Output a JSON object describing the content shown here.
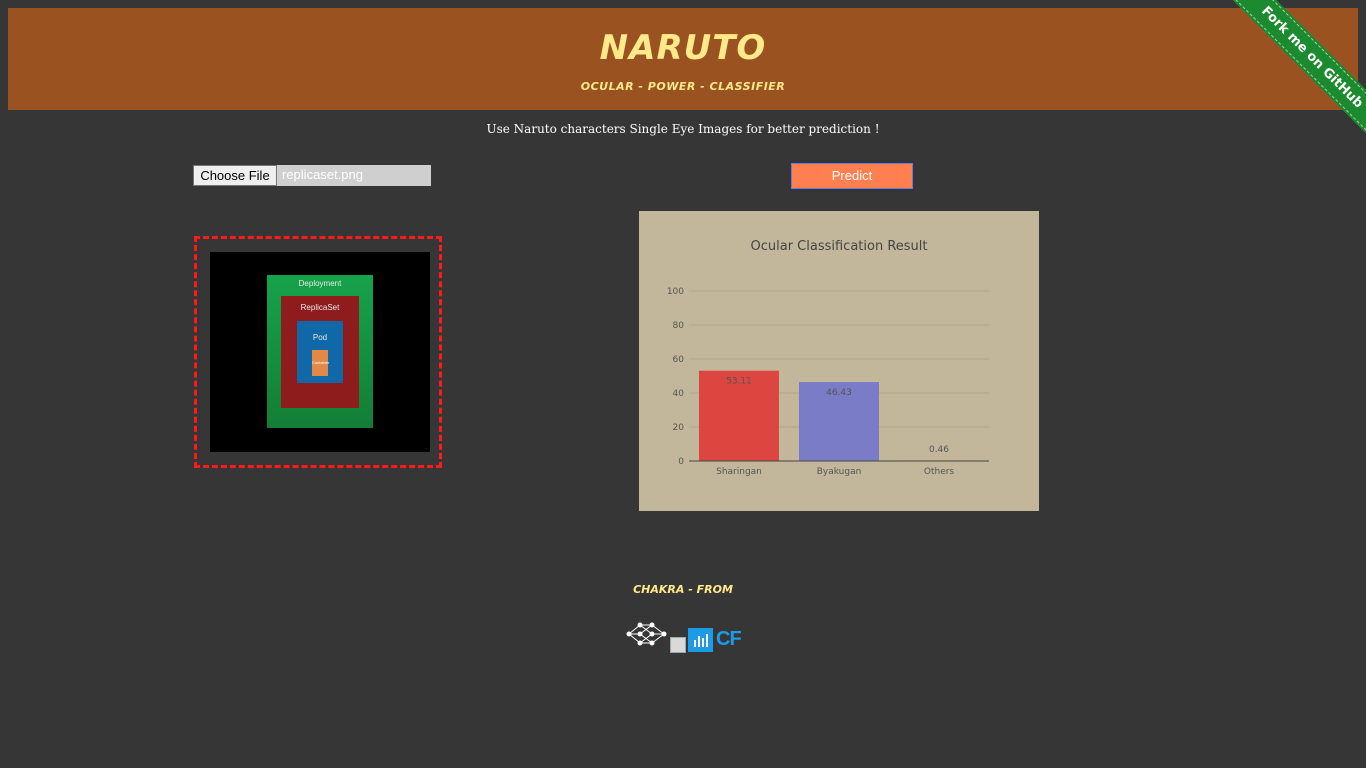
{
  "header": {
    "title": "Naruto",
    "subtitle": "Ocular - Power - Classifier"
  },
  "ribbon": {
    "label": "Fork me on GitHub"
  },
  "instructions": "Use Naruto characters Single Eye Images for better prediction !",
  "upload": {
    "choose_label": "Choose File",
    "file_name": "replicaset.png"
  },
  "predict": {
    "label": "Predict"
  },
  "preview": {
    "labels": {
      "outer": "Deployment",
      "mid": "ReplicaSet",
      "inner": "Pod",
      "core": "Container"
    }
  },
  "chart_data": {
    "type": "bar",
    "title": "Ocular Classification Result",
    "categories": [
      "Sharingan",
      "Byakugan",
      "Others"
    ],
    "values": [
      53.11,
      46.43,
      0.46
    ],
    "value_labels": [
      "53.11",
      "46.43",
      "0.46"
    ],
    "colors": [
      "#dc4540",
      "#7a7cc8",
      "#c8b26f"
    ],
    "ylim": [
      0,
      100
    ],
    "yticks": [
      0,
      20,
      40,
      60,
      80,
      100
    ],
    "grid": true,
    "background": "#c2b79a"
  },
  "footer": {
    "chakra_label": "Chakra - From"
  },
  "colors": {
    "page_bg": "#363636",
    "header_bg": "#9a5320",
    "accent_yellow": "#ffe98a",
    "predict_bg": "#ff7f50",
    "ribbon_green": "#1c8a2e"
  }
}
